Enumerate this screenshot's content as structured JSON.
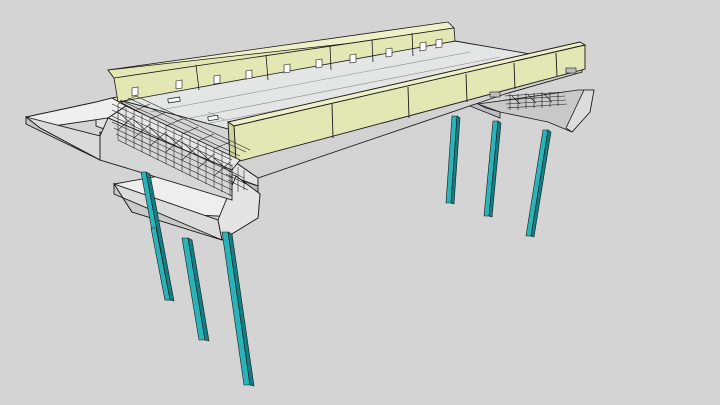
{
  "viewport": {
    "background_color": "#d4d4d4"
  },
  "model": {
    "subject": "bridge-3d-model",
    "colors": {
      "concrete_light": "#eeeeee",
      "concrete_mid": "#d9d9d9",
      "concrete_shadow": "#c4c4c4",
      "deck_top": "#e4e6e6",
      "barrier_face": "#e3e7b4",
      "barrier_top": "#eef1c8",
      "piles": "#2ab3b8",
      "piles_dark": "#137f84",
      "rebar": "#222222",
      "outline": "#1a1a1a"
    }
  }
}
